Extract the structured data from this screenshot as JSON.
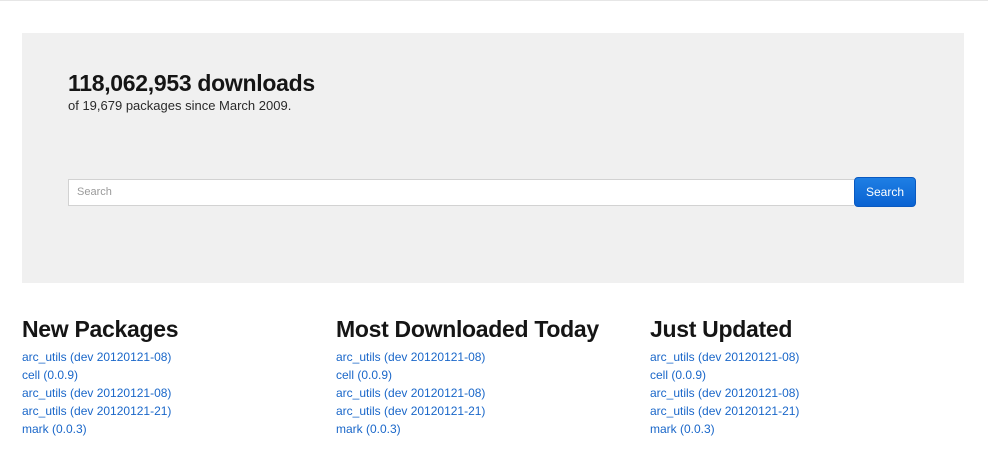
{
  "hero": {
    "stat": "118,062,953 downloads",
    "subtitle": "of 19,679 packages since March 2009."
  },
  "search": {
    "placeholder": "Search",
    "button_label": "Search"
  },
  "colors": {
    "hero_background": "#f0f0f0",
    "link": "#1a67c9",
    "button": "#0a63d2"
  },
  "columns": [
    {
      "title": "New Packages",
      "items": [
        "arc_utils (dev 20120121-08)",
        "cell (0.0.9)",
        "arc_utils (dev 20120121-08)",
        "arc_utils (dev 20120121-21)",
        "mark (0.0.3)"
      ]
    },
    {
      "title": "Most Downloaded Today",
      "items": [
        "arc_utils (dev 20120121-08)",
        "cell (0.0.9)",
        "arc_utils (dev 20120121-08)",
        "arc_utils (dev 20120121-21)",
        "mark (0.0.3)"
      ]
    },
    {
      "title": "Just Updated",
      "items": [
        "arc_utils (dev 20120121-08)",
        "cell (0.0.9)",
        "arc_utils (dev 20120121-08)",
        "arc_utils (dev 20120121-21)",
        "mark (0.0.3)"
      ]
    }
  ]
}
